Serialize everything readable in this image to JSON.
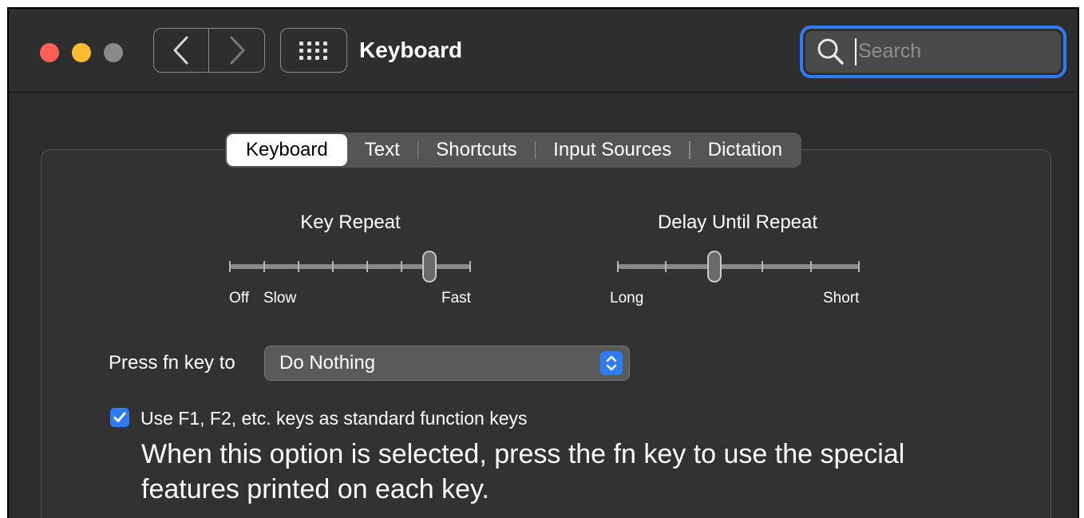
{
  "window": {
    "title": "Keyboard"
  },
  "search": {
    "placeholder": "Search"
  },
  "tabs": [
    {
      "label": "Keyboard",
      "selected": true
    },
    {
      "label": "Text",
      "selected": false
    },
    {
      "label": "Shortcuts",
      "selected": false
    },
    {
      "label": "Input Sources",
      "selected": false
    },
    {
      "label": "Dictation",
      "selected": false
    }
  ],
  "key_repeat": {
    "label": "Key Repeat",
    "min_label_off": "Off",
    "min_label": "Slow",
    "max_label": "Fast",
    "ticks": 8,
    "level": 0.83
  },
  "delay_until_repeat": {
    "label": "Delay Until Repeat",
    "min_label": "Long",
    "max_label": "Short",
    "ticks": 6,
    "level": 0.4
  },
  "fn_key": {
    "label": "Press fn key to",
    "value": "Do Nothing"
  },
  "function_keys": {
    "checked": true,
    "label": "Use F1, F2, etc. keys as standard function keys",
    "help": "When this option is selected, press the fn key to use the special features printed on each key."
  },
  "colors": {
    "accent": "#2f7bf6",
    "close": "#fe5f57",
    "minimize": "#febc2e",
    "window_bg": "#2c2c2c"
  },
  "icons": {
    "back": "chevron-left-icon",
    "forward": "chevron-right-icon",
    "grid": "grid-icon",
    "search": "search-icon",
    "popup": "up-down-chevron-icon",
    "check": "checkmark-icon"
  }
}
